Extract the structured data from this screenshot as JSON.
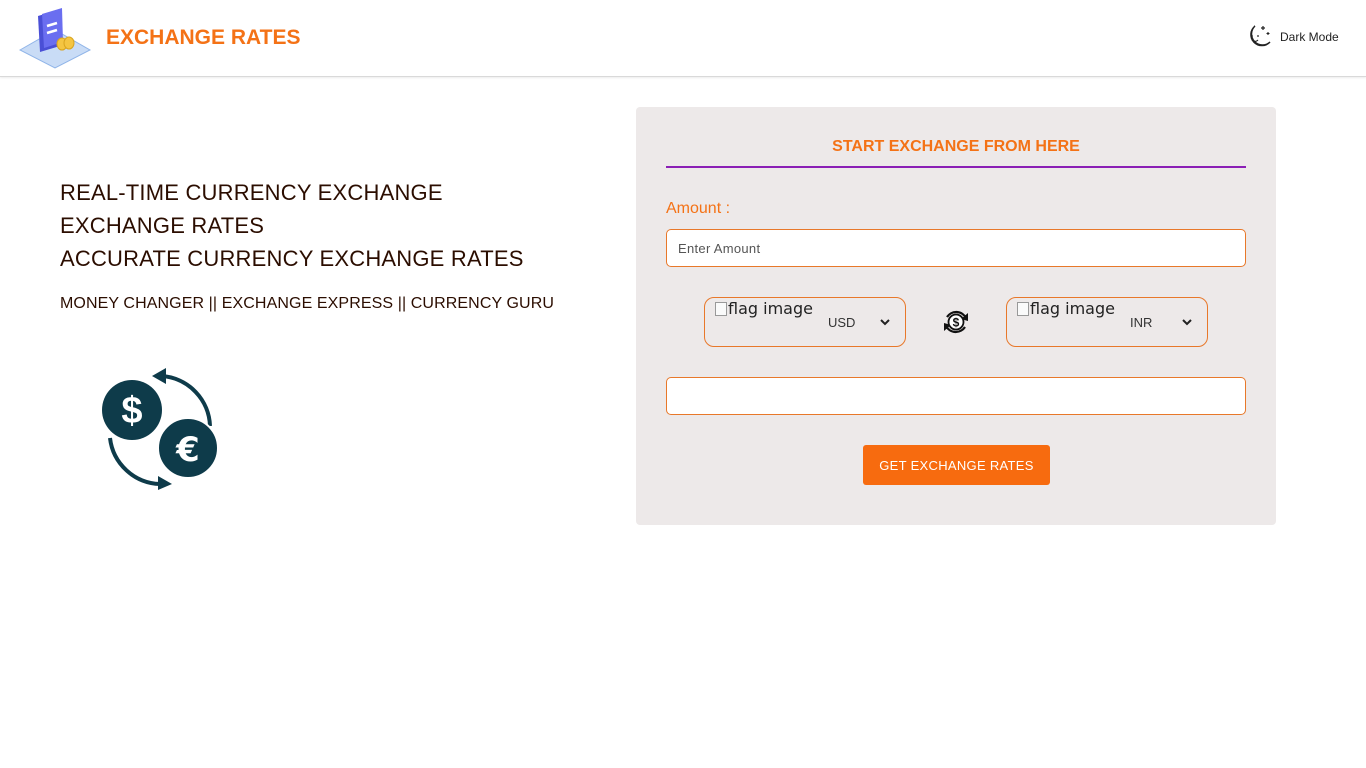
{
  "header": {
    "brand": "EXCHANGE RATES",
    "dark_mode_label": "Dark Mode"
  },
  "hero": {
    "lines": [
      "REAL-TIME CURRENCY EXCHANGE",
      "EXCHANGE RATES",
      "ACCURATE CURRENCY EXCHANGE RATES"
    ],
    "subtitle": "MONEY CHANGER || EXCHANGE EXPRESS || CURRENCY GURU"
  },
  "converter": {
    "title": "START EXCHANGE FROM HERE",
    "amount_label": "Amount :",
    "amount_placeholder": "Enter Amount",
    "amount_value": "",
    "from": {
      "flag_alt": "flag image",
      "code": "USD"
    },
    "to": {
      "flag_alt": "flag image",
      "code": "INR"
    },
    "result": "",
    "button": "GET EXCHANGE RATES"
  },
  "colors": {
    "accent": "#f47216",
    "button": "#f76b0f",
    "divider": "#8b1fb5",
    "card_bg": "#ede9e9",
    "heading_text": "#2b0d00"
  },
  "icons": {
    "logo": "exchange-rates-logo",
    "theme": "moon-icon",
    "swap": "swap-currency-icon",
    "hero": "dollar-euro-exchange-icon",
    "dropdown": "chevron-down-icon"
  }
}
